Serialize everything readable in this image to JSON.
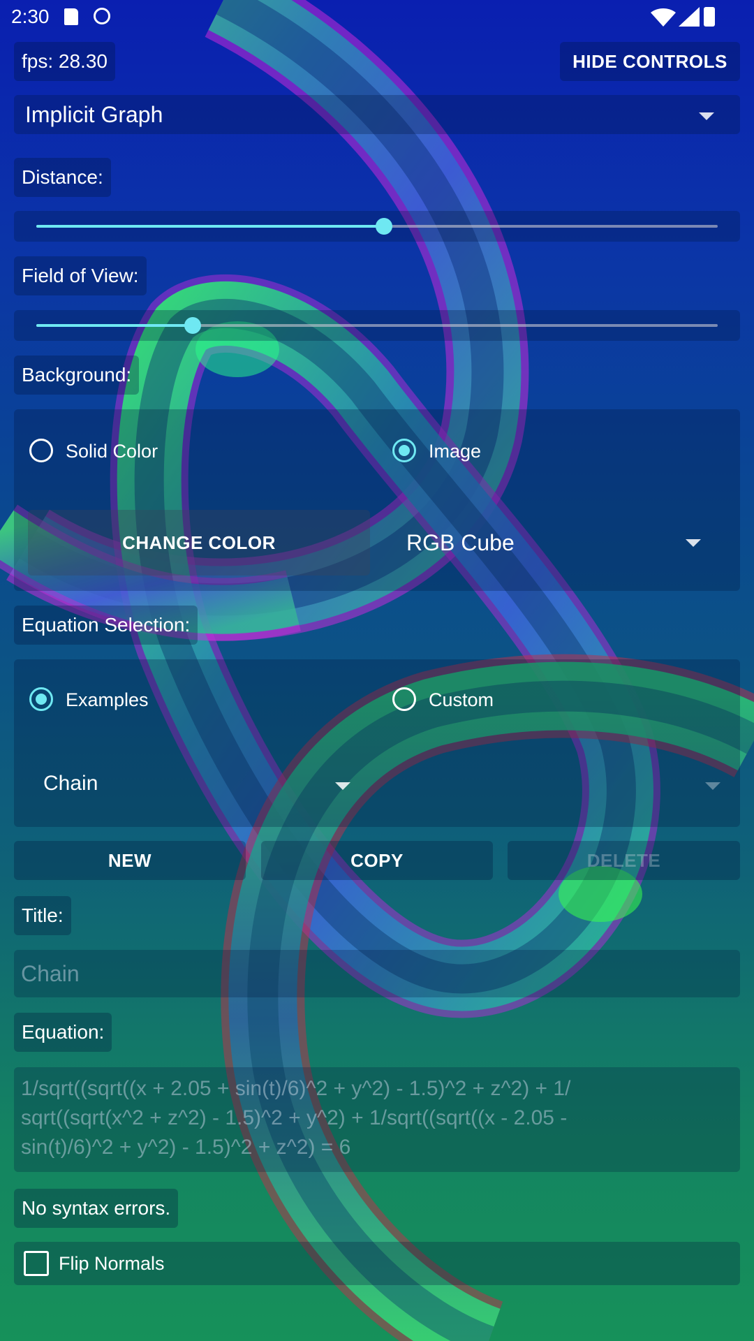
{
  "status_bar": {
    "time": "2:30"
  },
  "fps": {
    "label": "fps: 28.30"
  },
  "hide_controls": {
    "label": "HIDE CONTROLS"
  },
  "mode_dropdown": {
    "selected": "Implicit Graph"
  },
  "distance": {
    "label": "Distance:",
    "value_fraction": 0.51
  },
  "fov": {
    "label": "Field of View:",
    "value_fraction": 0.23
  },
  "background": {
    "label": "Background:",
    "options": [
      {
        "label": "Solid Color",
        "selected": false
      },
      {
        "label": "Image",
        "selected": true
      }
    ],
    "change_color_label": "CHANGE COLOR",
    "image_dropdown": "RGB Cube"
  },
  "equation_selection": {
    "label": "Equation Selection:",
    "options": [
      {
        "label": "Examples",
        "selected": true
      },
      {
        "label": "Custom",
        "selected": false
      }
    ],
    "example_dropdown": "Chain"
  },
  "actions": {
    "new": "NEW",
    "copy": "COPY",
    "delete": "DELETE"
  },
  "title": {
    "label": "Title:",
    "value": "Chain"
  },
  "equation": {
    "label": "Equation:",
    "lines": [
      "1/sqrt((sqrt((x + 2.05 + sin(t)/6)^2 + y^2) - 1.5)^2 + z^2) + 1/",
      "sqrt((sqrt(x^2 + z^2) - 1.5)^2 + y^2) + 1/sqrt((sqrt((x - 2.05 -",
      "sin(t)/6)^2 + y^2) - 1.5)^2 + z^2) = 6"
    ]
  },
  "syntax_status": "No syntax errors.",
  "flip_normals": {
    "label": "Flip Normals",
    "checked": false
  },
  "colors": {
    "accent": "#6fe8f2"
  }
}
